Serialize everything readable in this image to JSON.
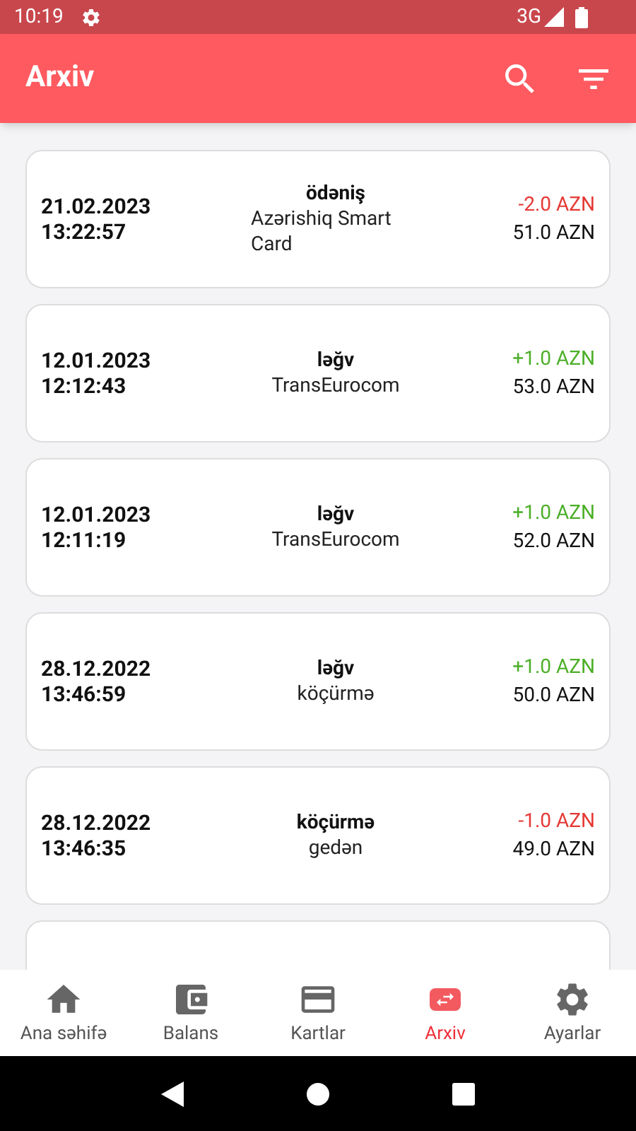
{
  "status_bar": {
    "time": "10:19",
    "network": "3G"
  },
  "app_bar": {
    "title": "Arxiv"
  },
  "transactions": [
    {
      "date": "21.02.2023",
      "time": "13:22:57",
      "type": "ödəniş",
      "description": "Azərishiq Smart Card",
      "amount": "-2.0 AZN",
      "kind": "debit",
      "balance": "51.0 AZN"
    },
    {
      "date": "12.01.2023",
      "time": "12:12:43",
      "type": "ləğv",
      "description": "TransEurocom",
      "amount": "+1.0 AZN",
      "kind": "credit",
      "balance": "53.0 AZN"
    },
    {
      "date": "12.01.2023",
      "time": "12:11:19",
      "type": "ləğv",
      "description": "TransEurocom",
      "amount": "+1.0 AZN",
      "kind": "credit",
      "balance": "52.0 AZN"
    },
    {
      "date": "28.12.2022",
      "time": "13:46:59",
      "type": "ləğv",
      "description": "köçürmə",
      "amount": "+1.0 AZN",
      "kind": "credit",
      "balance": "50.0 AZN"
    },
    {
      "date": "28.12.2022",
      "time": "13:46:35",
      "type": "köçürmə",
      "description": "gedən",
      "amount": "-1.0 AZN",
      "kind": "debit",
      "balance": "49.0 AZN"
    },
    {
      "kind": "hidden"
    }
  ],
  "bottom_nav": [
    {
      "label": "Ana səhifə",
      "kind": "home",
      "selected": false
    },
    {
      "label": "Balans",
      "kind": "wallet",
      "selected": false
    },
    {
      "label": "Kartlar",
      "kind": "card",
      "selected": false
    },
    {
      "label": "Arxiv",
      "kind": "archive",
      "selected": true
    },
    {
      "label": "Ayarlar",
      "kind": "settings",
      "selected": false
    }
  ]
}
